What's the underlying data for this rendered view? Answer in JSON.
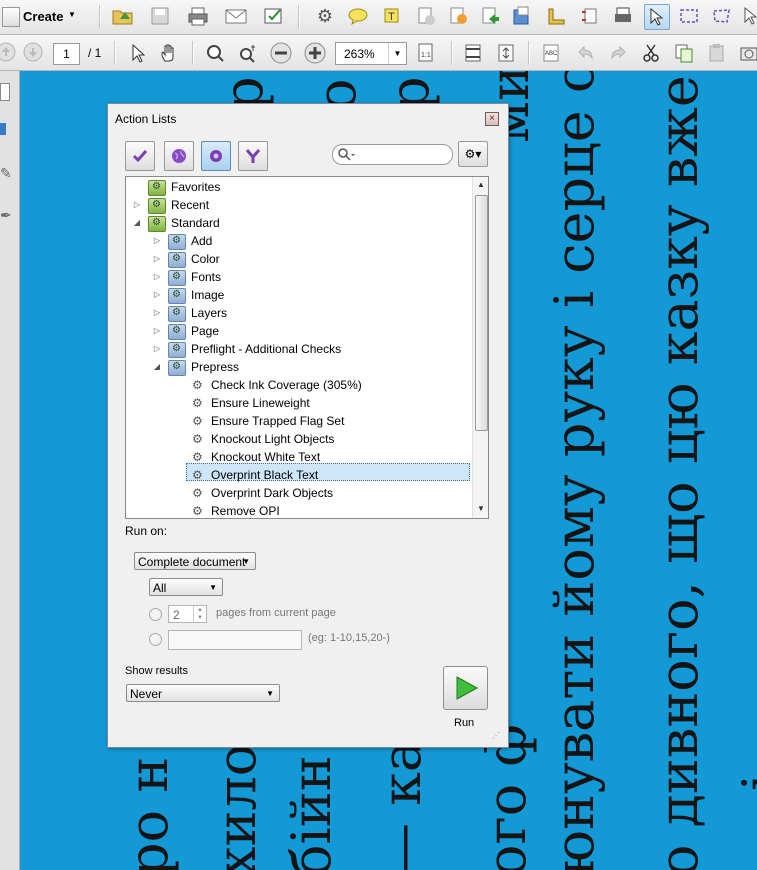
{
  "toolbar1": {
    "create_label": "Create"
  },
  "toolbar2": {
    "page_current": "1",
    "page_total": "/ 1",
    "zoom_value": "263%"
  },
  "document": {
    "text_columns": [
      "ро н",
      "хило",
      "бійн",
      "— ка",
      "ого ф",
      "юнувати йому руку і серце св",
      "о дивного, що цю казку вже п",
      "і"
    ],
    "top_glyphs": [
      "р",
      "о",
      "р",
      "ми"
    ]
  },
  "dialog": {
    "title": "Action Lists",
    "close_label": "×",
    "gear_label": "⚙▾",
    "tree": [
      {
        "label": "Favorites",
        "level": 0,
        "expander": "",
        "icon": "green"
      },
      {
        "label": "Recent",
        "level": 0,
        "expander": "▷",
        "icon": "green"
      },
      {
        "label": "Standard",
        "level": 0,
        "expander": "◢",
        "icon": "green"
      },
      {
        "label": "Add",
        "level": 1,
        "expander": "▷",
        "icon": "blue"
      },
      {
        "label": "Color",
        "level": 1,
        "expander": "▷",
        "icon": "blue"
      },
      {
        "label": "Fonts",
        "level": 1,
        "expander": "▷",
        "icon": "blue"
      },
      {
        "label": "Image",
        "level": 1,
        "expander": "▷",
        "icon": "blue"
      },
      {
        "label": "Layers",
        "level": 1,
        "expander": "▷",
        "icon": "blue"
      },
      {
        "label": "Page",
        "level": 1,
        "expander": "▷",
        "icon": "blue"
      },
      {
        "label": "Preflight - Additional Checks",
        "level": 1,
        "expander": "▷",
        "icon": "blue"
      },
      {
        "label": "Prepress",
        "level": 1,
        "expander": "◢",
        "icon": "blue"
      },
      {
        "label": "Check Ink Coverage (305%)",
        "level": 2,
        "expander": "",
        "icon": "action"
      },
      {
        "label": "Ensure Lineweight",
        "level": 2,
        "expander": "",
        "icon": "action"
      },
      {
        "label": "Ensure Trapped Flag Set",
        "level": 2,
        "expander": "",
        "icon": "action"
      },
      {
        "label": "Knockout Light Objects",
        "level": 2,
        "expander": "",
        "icon": "action"
      },
      {
        "label": "Knockout White Text",
        "level": 2,
        "expander": "",
        "icon": "action"
      },
      {
        "label": "Overprint Black Text",
        "level": 2,
        "expander": "",
        "icon": "action",
        "selected": true
      },
      {
        "label": "Overprint Dark Objects",
        "level": 2,
        "expander": "",
        "icon": "action"
      },
      {
        "label": "Remove OPI",
        "level": 2,
        "expander": "",
        "icon": "action"
      }
    ],
    "run_on_label": "Run on:",
    "scope_value": "Complete document",
    "pages_value": "All",
    "pages_count": "2",
    "pages_from_label": "pages from current page",
    "range_hint": "(eg: 1-10,15,20-)",
    "show_results_label": "Show results",
    "show_results_value": "Never",
    "run_label": "Run"
  }
}
